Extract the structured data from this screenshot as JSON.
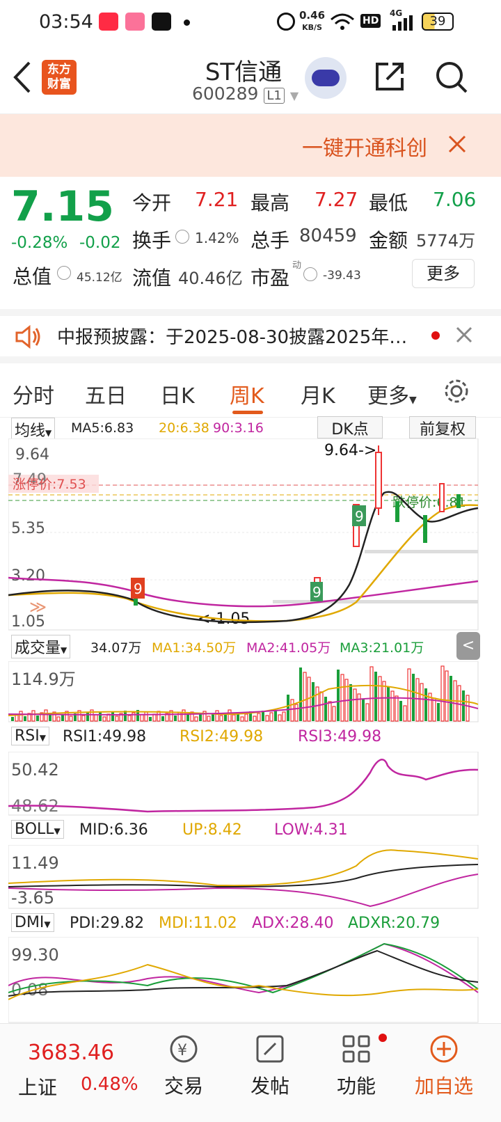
{
  "status": {
    "time": "03:54",
    "net_speed": "0.46",
    "net_unit": "KB/S",
    "battery": "39",
    "hd": "HD",
    "g4": "4G"
  },
  "header": {
    "title": "ST信通",
    "code": "600289",
    "level": "L1"
  },
  "banner": {
    "text": "一键开通科创"
  },
  "quote": {
    "price": "7.15",
    "pct": "-0.28%",
    "chg": "-0.02",
    "open_label": "今开",
    "open": "7.21",
    "high_label": "最高",
    "high": "7.27",
    "low_label": "最低",
    "low": "7.06",
    "turn_label": "换手",
    "turn": "1.42%",
    "vol_label": "总手",
    "vol": "80459",
    "amt_label": "金额",
    "amt": "5774万",
    "mcap_label": "总值",
    "mcap": "45.12亿",
    "float_label": "流值",
    "float": "40.46亿",
    "pe_label": "市盈",
    "pe": "-39.43",
    "pe_sup": "动",
    "more": "更多"
  },
  "notice": {
    "text": "中报预披露：于2025-08-30披露2025年…"
  },
  "tabs": [
    "分时",
    "五日",
    "日K",
    "周K",
    "月K",
    "更多"
  ],
  "ma": {
    "sel": "均线",
    "ma5": "MA5:6.83",
    "ma20": "20:6.38",
    "ma90": "90:3.16",
    "dk": "DK点",
    "fq": "前复权"
  },
  "kchart": {
    "y1": "9.64",
    "y2": "7.49",
    "y3": "5.35",
    "y4": "3.20",
    "y5": "1.05",
    "max": "9.64->",
    "min": "<-1.05",
    "limit_up": "涨停价:7.53",
    "limit_down": "跌停价:6.81"
  },
  "vol": {
    "sel": "成交量",
    "v": "34.07万",
    "ma1": "MA1:34.50万",
    "ma2": "MA2:41.05万",
    "ma3": "MA3:21.01万",
    "y": "114.9万"
  },
  "rsi": {
    "sel": "RSI",
    "r1": "RSI1:49.98",
    "r2": "RSI2:49.98",
    "r3": "RSI3:49.98",
    "y1": "50.42",
    "y2": "48.62"
  },
  "boll": {
    "sel": "BOLL",
    "mid": "MID:6.36",
    "up": "UP:8.42",
    "low": "LOW:4.31",
    "y1": "11.49",
    "y2": "-3.65"
  },
  "dmi": {
    "sel": "DMI",
    "pdi": "PDI:29.82",
    "mdi": "MDI:11.02",
    "adx": "ADX:28.40",
    "adxr": "ADXR:20.79",
    "y1": "99.30",
    "y2": "0.08"
  },
  "footer": {
    "index_val": "3683.46",
    "index_name": "上证",
    "index_pct": "0.48%",
    "trade": "交易",
    "post": "发帖",
    "func": "功能",
    "add": "加自选"
  }
}
